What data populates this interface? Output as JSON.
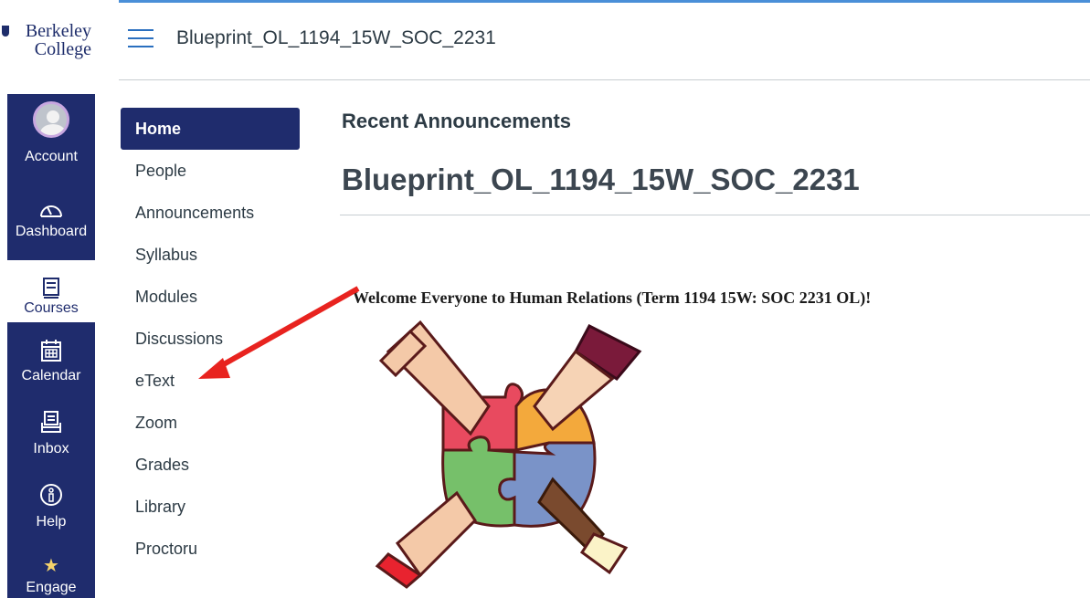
{
  "logo": {
    "line1": "Berkeley",
    "line2": "College"
  },
  "global_nav": {
    "items": [
      {
        "label": "Account",
        "icon": "avatar-icon"
      },
      {
        "label": "Dashboard",
        "icon": "speedometer-icon"
      },
      {
        "label": "Courses",
        "icon": "book-icon",
        "active": true
      },
      {
        "label": "Calendar",
        "icon": "calendar-icon"
      },
      {
        "label": "Inbox",
        "icon": "inbox-icon"
      },
      {
        "label": "Help",
        "icon": "info-icon"
      },
      {
        "label": "Engage",
        "icon": "star-icon"
      }
    ]
  },
  "header": {
    "course_title": "Blueprint_OL_1194_15W_SOC_2231"
  },
  "course_nav": {
    "items": [
      {
        "label": "Home",
        "active": true
      },
      {
        "label": "People"
      },
      {
        "label": "Announcements"
      },
      {
        "label": "Syllabus"
      },
      {
        "label": "Modules"
      },
      {
        "label": "Discussions"
      },
      {
        "label": "eText"
      },
      {
        "label": "Zoom"
      },
      {
        "label": "Grades"
      },
      {
        "label": "Library"
      },
      {
        "label": "Proctoru"
      }
    ]
  },
  "main": {
    "recent_announcements": "Recent Announcements",
    "page_heading": "Blueprint_OL_1194_15W_SOC_2231",
    "welcome_text": "Welcome Everyone to Human Relations (Term 1194 15W: SOC 2231 OL)!"
  },
  "colors": {
    "nav_bg": "#1f2c6d",
    "accent": "#2a6fbf",
    "arrow": "#e8231f"
  }
}
